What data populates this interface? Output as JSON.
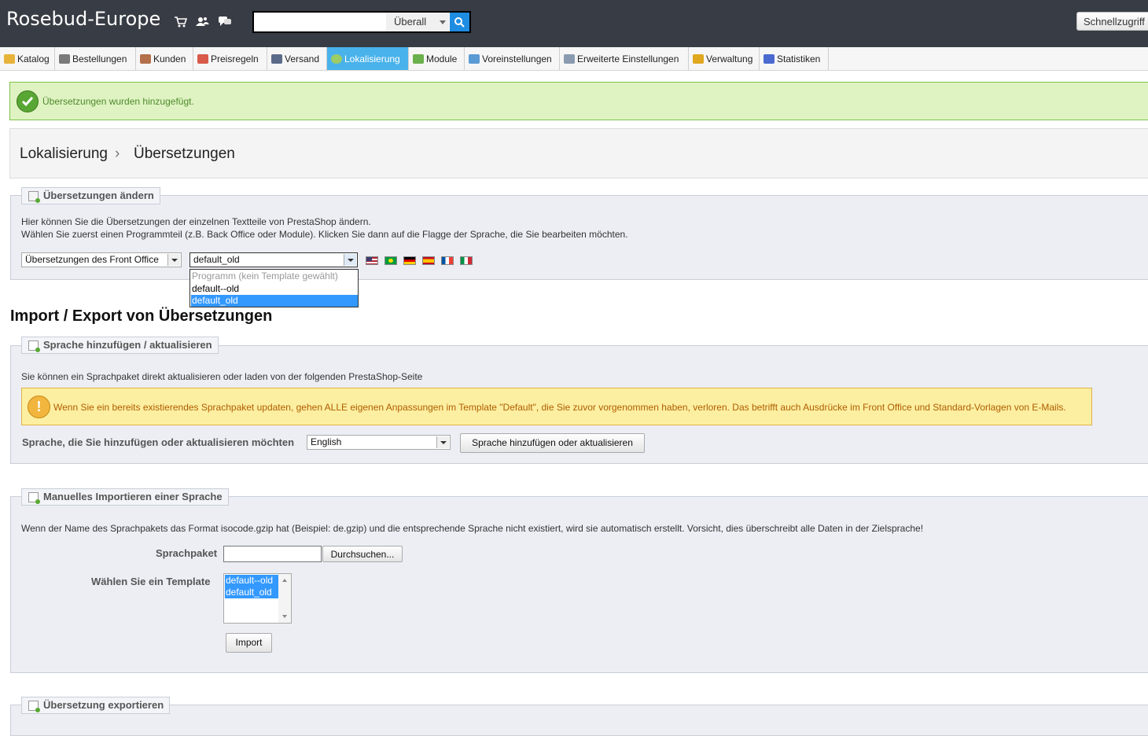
{
  "header": {
    "shop_name": "Rosebud-Europe",
    "search": {
      "value": "",
      "placeholder": "",
      "scope": "Überall"
    },
    "quick_access": "Schnellzugriff",
    "icons": [
      "cart-icon",
      "customers-icon",
      "messages-icon",
      "search-icon"
    ]
  },
  "tabs": [
    {
      "label": "Katalog",
      "icon": "folder-icon",
      "color": "#e8b33a"
    },
    {
      "label": "Bestellungen",
      "icon": "cart-icon",
      "color": "#7a7a7a"
    },
    {
      "label": "Kunden",
      "icon": "user-icon",
      "color": "#b4704a"
    },
    {
      "label": "Preisregeln",
      "icon": "price-rules-icon",
      "color": "#d85a4a"
    },
    {
      "label": "Versand",
      "icon": "truck-icon",
      "color": "#5a6b8a"
    },
    {
      "label": "Lokalisierung",
      "icon": "globe-icon",
      "color": "#9ccc65",
      "active": true
    },
    {
      "label": "Module",
      "icon": "puzzle-icon",
      "color": "#6ab04c"
    },
    {
      "label": "Voreinstellungen",
      "icon": "preferences-icon",
      "color": "#5a9ad5"
    },
    {
      "label": "Erweiterte Einstellungen",
      "icon": "wrench-icon",
      "color": "#8a9ab0"
    },
    {
      "label": "Verwaltung",
      "icon": "key-icon",
      "color": "#e0a820"
    },
    {
      "label": "Statistiken",
      "icon": "bar-chart-icon",
      "color": "#4a6ad0"
    }
  ],
  "confirmation": {
    "text": "Übersetzungen wurden hinzugefügt."
  },
  "breadcrumb": {
    "first": "Lokalisierung",
    "separator": "›",
    "second": "Übersetzungen"
  },
  "modify": {
    "legend": "Übersetzungen ändern",
    "line1": "Hier können Sie die Übersetzungen der einzelnen Textteile von PrestaShop ändern.",
    "line2": "Wählen Sie zuerst einen Programmteil (z.B. Back Office oder Module). Klicken Sie dann auf die Flagge der Sprache, die Sie bearbeiten möchten.",
    "type_select": "Übersetzungen des Front Office",
    "theme_select": "default_old",
    "theme_options": [
      {
        "label": "Programm (kein Template gewählt)",
        "disabled": true
      },
      {
        "label": "default--old"
      },
      {
        "label": "default_old",
        "selected": true
      }
    ],
    "flags": [
      {
        "icon": "flag-us-icon",
        "colors": [
          "#b22234",
          "#ffffff",
          "#3c3b6e"
        ]
      },
      {
        "icon": "flag-br-icon",
        "colors": [
          "#009c3b",
          "#ffdf00",
          "#002776"
        ]
      },
      {
        "icon": "flag-de-icon",
        "colors": [
          "#000000",
          "#dd0000",
          "#ffce00"
        ]
      },
      {
        "icon": "flag-es-icon",
        "colors": [
          "#c60b1e",
          "#ffc400",
          "#c60b1e"
        ]
      },
      {
        "icon": "flag-fr-icon",
        "colors": [
          "#0055a4",
          "#ffffff",
          "#ef4135"
        ]
      },
      {
        "icon": "flag-it-icon",
        "colors": [
          "#009246",
          "#ffffff",
          "#ce2b37"
        ]
      }
    ]
  },
  "import_export": {
    "title": "Import / Export von Übersetzungen",
    "add": {
      "legend": "Sprache hinzufügen / aktualisieren",
      "intro": "Sie können ein Sprachpaket direkt aktualisieren oder laden von der folgenden PrestaShop-Seite",
      "warning": "Wenn Sie ein bereits existierendes Sprachpaket updaten, gehen ALLE eigenen Anpassungen im Template \"Default\", die Sie zuvor vorgenommen haben, verloren. Das betrifft auch Ausdrücke im Front Office und Standard-Vorlagen von E-Mails.",
      "label": "Sprache, die Sie hinzufügen oder aktualisieren möchten",
      "language": "English",
      "button": "Sprache hinzufügen oder aktualisieren"
    },
    "manual": {
      "legend": "Manuelles Importieren einer Sprache",
      "intro": "Wenn der Name des Sprachpakets das Format isocode.gzip hat (Beispiel: de.gzip) und die entsprechende Sprache nicht existiert, wird sie automatisch erstellt. Vorsicht, dies überschreibt alle Daten in der Zielsprache!",
      "file_label": "Sprachpaket",
      "file_value": "",
      "browse": "Durchsuchen...",
      "template_label": "Wählen Sie ein Template",
      "templates": [
        "default--old",
        "default_old"
      ],
      "import_button": "Import"
    },
    "export": {
      "legend": "Übersetzung exportieren"
    }
  }
}
